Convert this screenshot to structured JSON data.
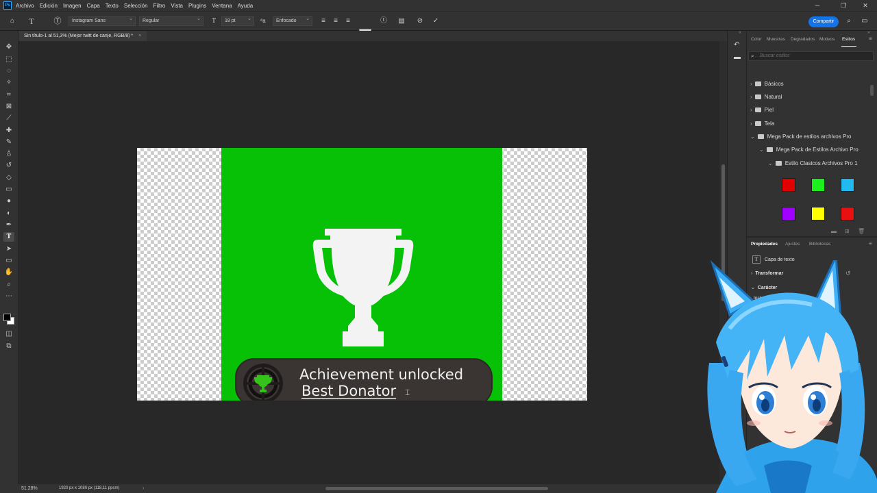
{
  "app": {
    "logo": "Ps",
    "menu": [
      "Archivo",
      "Edición",
      "Imagen",
      "Capa",
      "Texto",
      "Selección",
      "Filtro",
      "Vista",
      "Plugins",
      "Ventana",
      "Ayuda"
    ]
  },
  "options_bar": {
    "font_family": "Instagram Sans",
    "font_style": "Regular",
    "font_size": "18 pt",
    "antialias": "Enfocado",
    "share_label": "Compartir"
  },
  "document": {
    "tab_title": "Sin título-1 al 51,3% (Mejor twitt de canje, RGB/8) *",
    "canvas_content": {
      "achievement_title": "Achievement unlocked",
      "achievement_subtitle": "Best Donator"
    }
  },
  "status_bar": {
    "zoom": "51.28%",
    "doc_info": "1920 px x 1080 px (118,11 ppcm)"
  },
  "styles_panel": {
    "tabs": [
      "Color",
      "Muestras",
      "Degradados",
      "Motivos",
      "Estilos"
    ],
    "active_tab": "Estilos",
    "search_placeholder": "Buscar estilos",
    "tree": [
      {
        "label": "Básicos",
        "depth": 0
      },
      {
        "label": "Natural",
        "depth": 0
      },
      {
        "label": "Piel",
        "depth": 0
      },
      {
        "label": "Tela",
        "depth": 0
      },
      {
        "label": "Mega Pack de estilos archivos Pro",
        "depth": 0
      },
      {
        "label": "Mega Pack de Estilos Archivo Pro",
        "depth": 1
      },
      {
        "label": "Estilo Clasicos Archivos Pro 1",
        "depth": 2
      }
    ],
    "swatch_colors": [
      "#e00000",
      "#1cf01c",
      "#22b8f0",
      "#a000ff",
      "#ffff00",
      "#e81010"
    ]
  },
  "properties_panel": {
    "tabs": [
      "Propiedades",
      "Ajustes",
      "Bibliotecas"
    ],
    "active_tab": "Propiedades",
    "layer_type": "Capa de texto",
    "transform_section": "Transformar",
    "character_section": "Carácter",
    "character_font": "Instagram Sans"
  },
  "colors": {
    "card_green": "#07c107",
    "accent_blue": "#1473e6"
  }
}
